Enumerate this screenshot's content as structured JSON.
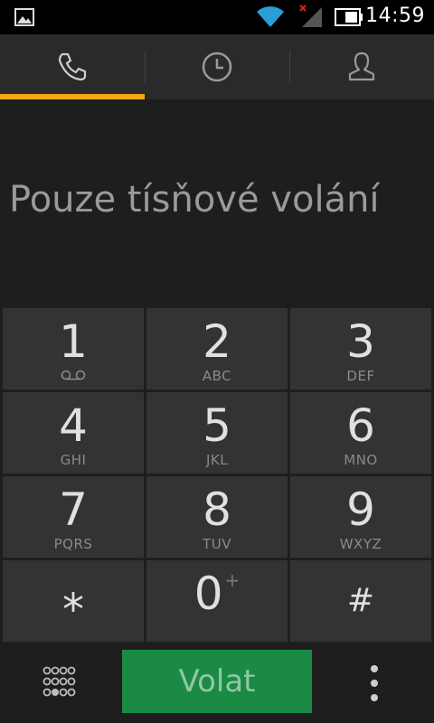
{
  "status_bar": {
    "time": "14:59"
  },
  "tabs": [
    {
      "name": "phone",
      "icon": "phone-icon",
      "active": true
    },
    {
      "name": "call-log",
      "icon": "clock-icon",
      "active": false
    },
    {
      "name": "contacts",
      "icon": "person-icon",
      "active": false
    }
  ],
  "display": {
    "text": "Pouze tísňové volání"
  },
  "keypad": {
    "keys": [
      {
        "digit": "1",
        "letters": ""
      },
      {
        "digit": "2",
        "letters": "ABC"
      },
      {
        "digit": "3",
        "letters": "DEF"
      },
      {
        "digit": "4",
        "letters": "GHI"
      },
      {
        "digit": "5",
        "letters": "JKL"
      },
      {
        "digit": "6",
        "letters": "MNO"
      },
      {
        "digit": "7",
        "letters": "PQRS"
      },
      {
        "digit": "8",
        "letters": "TUV"
      },
      {
        "digit": "9",
        "letters": "WXYZ"
      },
      {
        "digit": "*",
        "letters": ""
      },
      {
        "digit": "0",
        "letters": "",
        "secondary": "+"
      },
      {
        "digit": "#",
        "letters": ""
      }
    ]
  },
  "bottom_bar": {
    "call_label": "Volat"
  },
  "colors": {
    "accent": "#f0a818",
    "call_button": "#1a8a45",
    "key_background": "#333333"
  }
}
